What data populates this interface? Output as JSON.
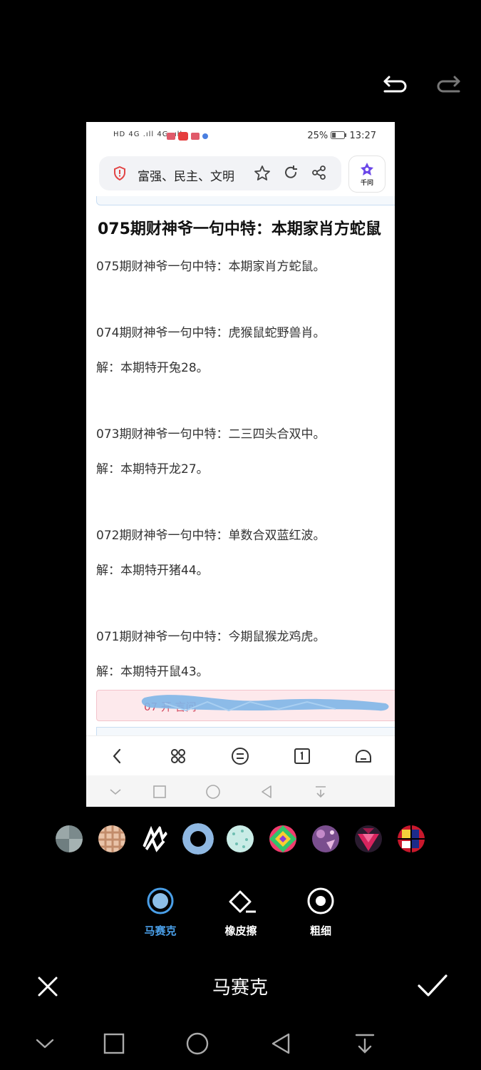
{
  "inner_screen": {
    "status_bar": {
      "network_indicators": "HD 4G .ıll 4G .ıll",
      "battery": "25%",
      "time": "13:27"
    },
    "address_bar": {
      "text": "富强、民主、文明"
    },
    "assistant_button": {
      "label": "千问"
    },
    "article": {
      "headline": "075期财神爷一句中特：本期家肖方蛇鼠",
      "lines": [
        "075期财神爷一句中特：本期家肖方蛇鼠。",
        "074期财神爷一句中特：虎猴鼠蛇野兽肖。",
        "解：本期特开兔28。",
        "073期财神爷一句中特：二三四头合双中。",
        "解：本期特开龙27。",
        "072期财神爷一句中特：单数合双蓝红波。",
        "解：本期特开猪44。",
        "071期财神爷一句中特：今期鼠猴龙鸡虎。",
        "解：本期特开鼠43。"
      ],
      "red_banner_visible_fragment": "07       开       言问"
    }
  },
  "editor": {
    "mosaic_styles": [
      "mosaic-blur",
      "mosaic-pixel",
      "mosaic-brush",
      "mosaic-circle-selected",
      "mosaic-dots",
      "mosaic-diamond-rainbow",
      "mosaic-purple-pattern",
      "mosaic-triangle-pink",
      "mosaic-blocks-red"
    ],
    "selected_style_index": 3,
    "tools": [
      {
        "label": "马赛克",
        "active": true
      },
      {
        "label": "橡皮擦",
        "active": false
      },
      {
        "label": "粗细",
        "active": false
      }
    ],
    "title": "马赛克",
    "accent_color": "#4a9fe8"
  }
}
